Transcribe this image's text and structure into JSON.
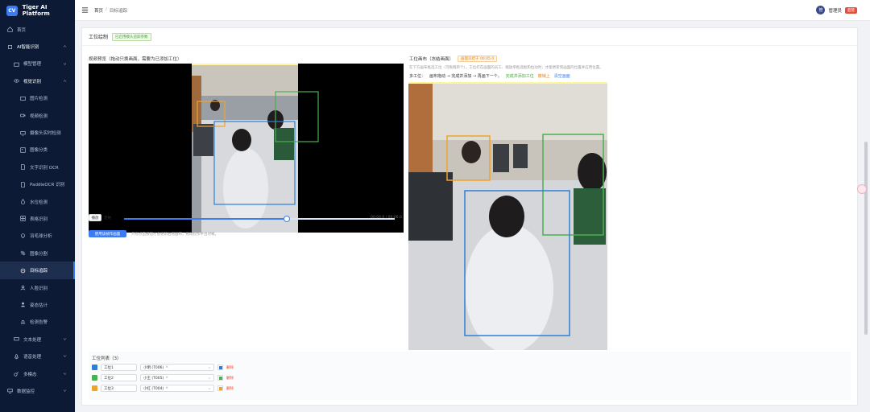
{
  "app": {
    "logo": "CV",
    "name": "Tiger AI Platform"
  },
  "sidebar": {
    "home": "首页",
    "ai_group": "AI智能识别",
    "model_mgmt": "模型管理",
    "vision": "视觉识别",
    "vision_items": [
      "图片检测",
      "视频检测",
      "摄像头实时检测",
      "图像分类",
      "文字识别 OCR",
      "PaddleOCR 识别",
      "水位检测",
      "表格识别",
      "羽毛球分析",
      "图像分割",
      "目标追踪",
      "人脸识别",
      "姿态估计",
      "检测告警"
    ],
    "text": "文本处理",
    "speech": "语音处理",
    "multimodal": "多模态",
    "monitor": "数据监控"
  },
  "topbar": {
    "crumb_home": "首页",
    "crumb_sep": "/",
    "crumb_current": "目标追踪",
    "avatar": "管",
    "username": "管理员",
    "user_tag": "超管"
  },
  "page": {
    "section_title": "工位绘制",
    "section_tag": "已启用模头追踪参数",
    "left_title": "视频预览（拖动只换画面，需要为已添加工位）",
    "play_label": "播放",
    "fix_label": "定格",
    "progress": 0.6,
    "time": "00:04.6 / 00:06.0",
    "apply_button": "使用该帧作画面",
    "hint": "只有点击按钮才会更新右侧画布，拖动仅作平台对帧。",
    "right_title": "工位画布（冻结画面）",
    "right_tag": "画面冻结于 00:05.0",
    "right_desc": "在下方画布框选工位（可拖拽单个），工位打在画面的员工、缩放单框选框和拉动时，才能更新到画面的位置并应用位置。",
    "flow": {
      "prefix": "多工位：",
      "steps": "画布拖动 → 完成并添加 → 再画下一个。",
      "link1": "完成并添加工位",
      "link2": "撤销上",
      "link3": "清空画面"
    }
  },
  "stations": {
    "title": "工位列表（3）",
    "rows": [
      {
        "name": "工位1",
        "person": "小明 (T006)",
        "color": "#2f7fd8"
      },
      {
        "name": "工位2",
        "person": "小王 (T005)",
        "color": "#4caf50"
      },
      {
        "name": "工位3",
        "person": "小红 (T004)",
        "color": "#f0a32c"
      }
    ],
    "delete_label": "删除",
    "remove_mark": "×"
  },
  "colors": {
    "accent": "#3b7cf4",
    "sidebar_bg": "#0c1a35",
    "box_blue": "#2f7fd8",
    "box_green": "#4caf50",
    "box_orange": "#f0a32c"
  },
  "icons": [
    "home-icon",
    "cpu-icon",
    "box-icon",
    "eye-icon",
    "image-icon",
    "video-icon",
    "camera-icon",
    "grid-icon",
    "text-icon",
    "doc-icon",
    "drop-icon",
    "table-icon",
    "bulb-icon",
    "crop-icon",
    "target-icon",
    "face-icon",
    "person-icon",
    "bell-icon",
    "chat-icon",
    "mic-icon",
    "layers-icon",
    "monitor-icon"
  ]
}
